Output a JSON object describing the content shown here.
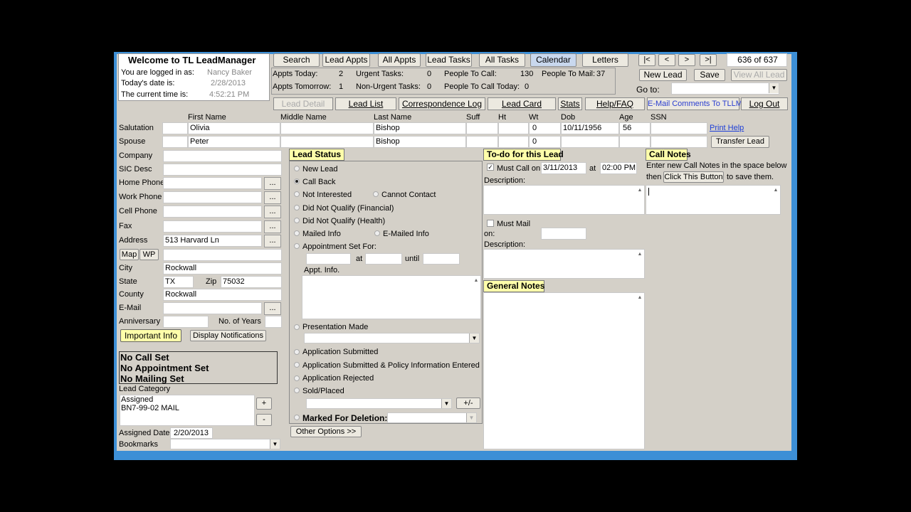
{
  "welcome": {
    "title": "Welcome to TL LeadManager",
    "logged_label": "You are logged in as:",
    "logged_value": "Nancy Baker",
    "date_label": "Today's date is:",
    "date_value": "2/28/2013",
    "time_label": "The current time is:",
    "time_value": "4:52:21 PM"
  },
  "toolbar": {
    "search": "Search",
    "lead_appts": "Lead Appts",
    "all_appts": "All Appts",
    "lead_tasks": "Lead Tasks",
    "all_tasks": "All Tasks",
    "calendar": "Calendar",
    "letters": "Letters",
    "nav_first": "|<",
    "nav_prev": "<",
    "nav_next": ">",
    "nav_last": ">|",
    "record_pos": "636 of 637",
    "new_lead": "New Lead",
    "save": "Save",
    "view_all_lead": "View All Lead",
    "goto_label": "Go to:"
  },
  "stats": {
    "appts_today_label": "Appts Today:",
    "appts_today": "2",
    "urgent_label": "Urgent Tasks:",
    "urgent": "0",
    "people_call_label": "People To Call:",
    "people_call": "130",
    "people_mail_label": "People To Mail:",
    "people_mail": "37",
    "appts_tomorrow_label": "Appts Tomorrow:",
    "appts_tomorrow": "1",
    "nonurgent_label": "Non-Urgent Tasks:",
    "nonurgent": "0",
    "people_call_today_label": "People To Call Today:",
    "people_call_today": "0"
  },
  "tabs": {
    "lead_detail": "Lead Detail",
    "lead_list": "Lead List",
    "correspondence": "Correspondence Log",
    "lead_card": "Lead Card",
    "stats": "Stats",
    "help": "Help/FAQ",
    "email": "E-Mail Comments To TLLM",
    "logout": "Log Out"
  },
  "names": {
    "col_first": "First Name",
    "col_middle": "Middle Name",
    "col_last": "Last Name",
    "col_suff": "Suff",
    "col_ht": "Ht",
    "col_wt": "Wt",
    "col_dob": "Dob",
    "col_age": "Age",
    "col_ssn": "SSN",
    "salutation_label": "Salutation",
    "spouse_label": "Spouse",
    "first": "Olivia",
    "last": "Bishop",
    "wt": "0",
    "dob": "10/11/1956",
    "age": "56",
    "sp_first": "Peter",
    "sp_last": "Bishop",
    "sp_wt": "0",
    "print_help": "Print Help",
    "transfer_lead": "Transfer Lead"
  },
  "contact": {
    "company": "Company",
    "sic": "SIC Desc",
    "home": "Home Phone",
    "work": "Work Phone",
    "cell": "Cell Phone",
    "fax": "Fax",
    "address_label": "Address",
    "address": "513 Harvard Ln",
    "map": "Map",
    "wp": "WP",
    "city_label": "City",
    "city": "Rockwall",
    "state_label": "State",
    "state": "TX",
    "zip_label": "Zip",
    "zip": "75032",
    "county_label": "County",
    "county": "Rockwall",
    "email_label": "E-Mail",
    "anniv_label": "Anniversary",
    "years_label": "No. of Years",
    "dots": "...",
    "important": "Important Info",
    "notifications": "Display Notifications",
    "no_call": "No Call Set",
    "no_appt": "No Appointment Set",
    "no_mail": "No Mailing Set",
    "category_label": "Lead Category",
    "cat1": "Assigned",
    "cat2": "BN7-99-02 MAIL",
    "plus": "+",
    "minus": "-",
    "assigned_label": "Assigned Date",
    "assigned_date": "2/20/2013",
    "bookmarks_label": "Bookmarks"
  },
  "status": {
    "header": "Lead Status",
    "new_lead": "New Lead",
    "call_back": "Call Back",
    "not_interested": "Not Interested",
    "cannot_contact": "Cannot Contact",
    "dnq_fin": "Did Not Qualify (Financial)",
    "dnq_health": "Did Not Qualify (Health)",
    "mailed": "Mailed Info",
    "emailed": "E-Mailed Info",
    "appt_set": "Appointment Set For:",
    "at": "at",
    "until": "until",
    "appt_info": "Appt. Info.",
    "presentation": "Presentation Made",
    "app_submitted": "Application Submitted",
    "app_policy": "Application Submitted & Policy Information Entered",
    "app_rejected": "Application Rejected",
    "sold": "Sold/Placed",
    "plusminus": "+/-",
    "marked_delete": "Marked For Deletion:",
    "other_options": "Other Options >>"
  },
  "todo": {
    "header": "To-do for this Lead",
    "must_call": "Must Call on:",
    "call_date": "3/11/2013",
    "at": "at",
    "call_time": "02:00 PM",
    "description": "Description:",
    "must_mail": "Must Mail",
    "on": "on:",
    "description2": "Description:",
    "general_notes": "General Notes"
  },
  "callnotes": {
    "header": "Call Notes",
    "line1": "Enter new Call Notes in the space below",
    "then": "then",
    "button": "Click This Button",
    "tosave": "to save them."
  }
}
